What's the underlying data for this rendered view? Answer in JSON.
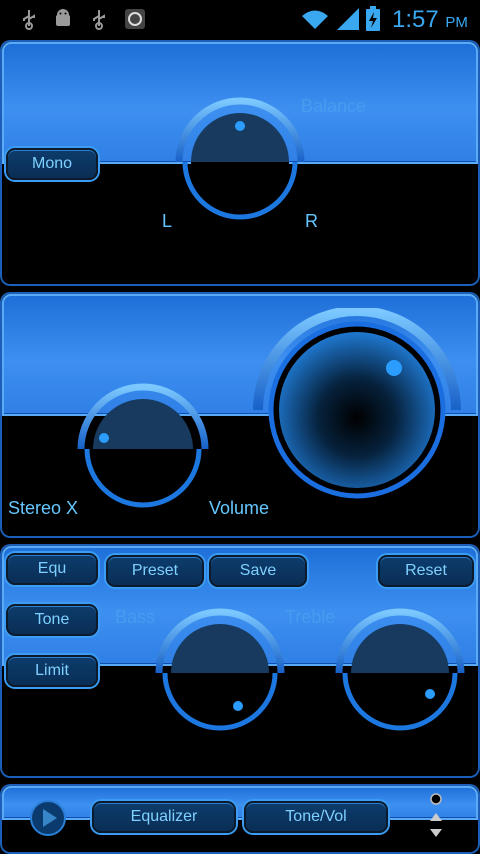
{
  "status": {
    "time": "1:57",
    "ampm": "PM"
  },
  "balance_panel": {
    "title": "Balance",
    "mono_label": "Mono",
    "left_label": "L",
    "right_label": "R"
  },
  "volume_panel": {
    "stereo_label": "Stereo X",
    "volume_label": "Volume"
  },
  "eq_panel": {
    "equ_label": "Equ",
    "preset_label": "Preset",
    "save_label": "Save",
    "reset_label": "Reset",
    "tone_label": "Tone",
    "limit_label": "Limit",
    "bass_label": "Bass",
    "treble_label": "Treble"
  },
  "bottom_bar": {
    "equalizer_label": "Equalizer",
    "tonevol_label": "Tone/Vol"
  },
  "colors": {
    "accent": "#3d8ff0",
    "text": "#66c7ff",
    "background": "#000000"
  }
}
